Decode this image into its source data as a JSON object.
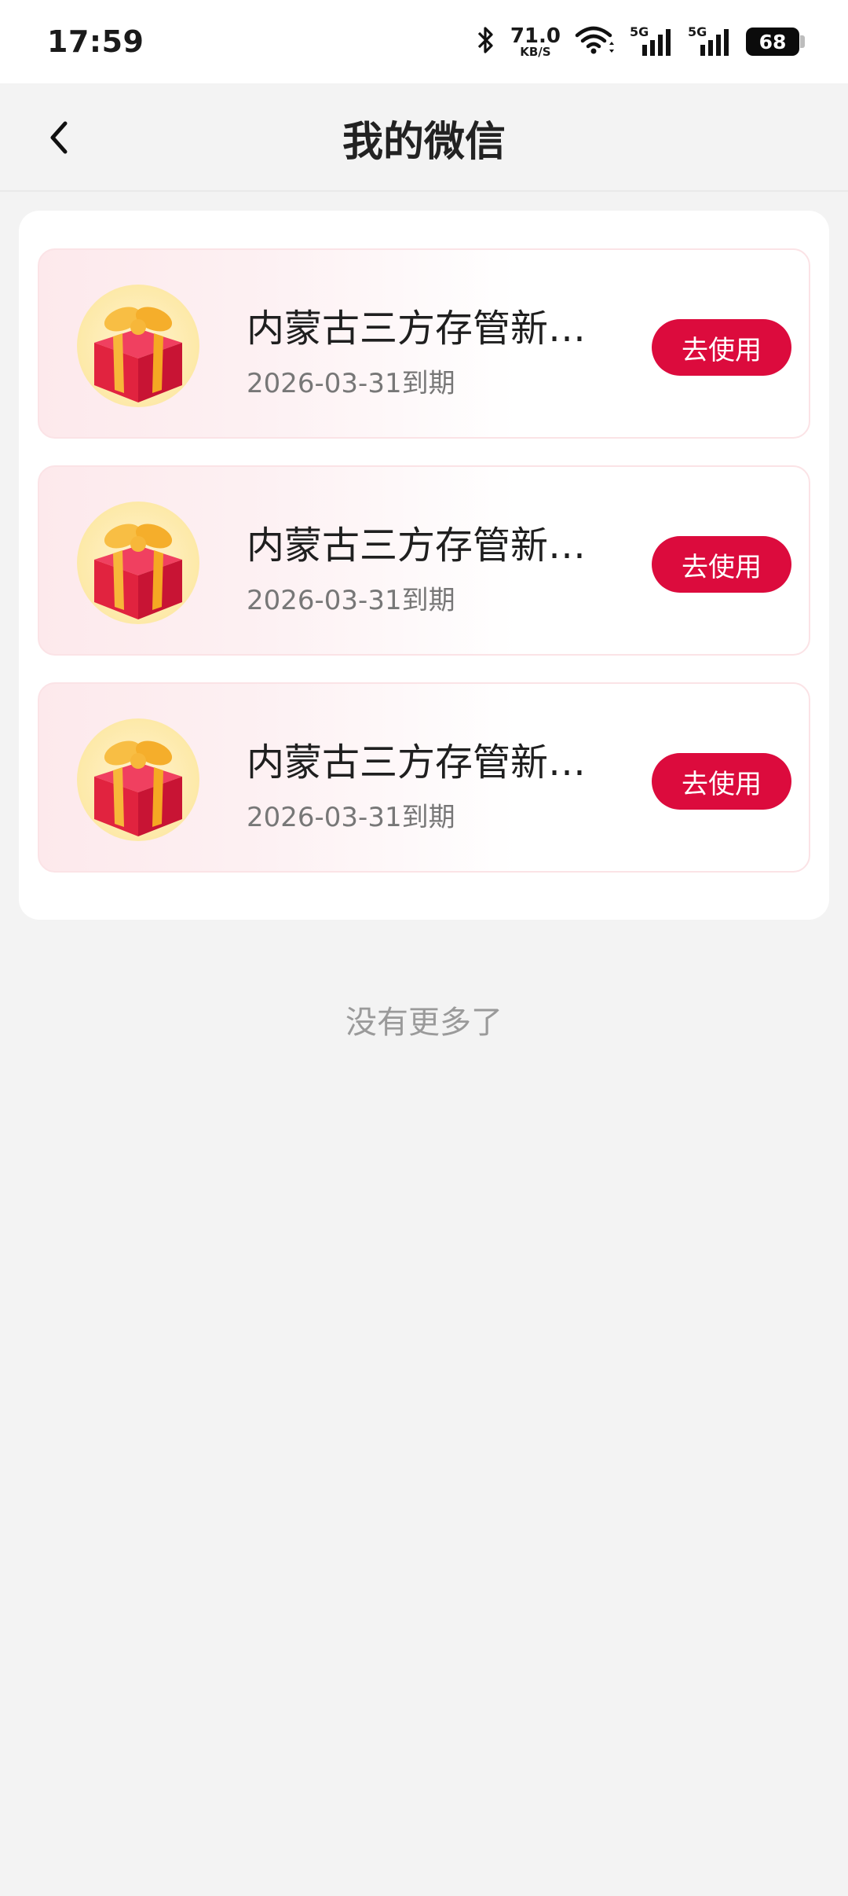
{
  "status_bar": {
    "time": "17:59",
    "net_speed_value": "71.0",
    "net_speed_unit": "KB/S",
    "signal1_label": "5G",
    "signal2_label": "5G",
    "battery": "68",
    "icons": [
      "bluetooth-icon",
      "wifi-icon",
      "signal-icon",
      "signal-icon",
      "battery-icon"
    ]
  },
  "nav": {
    "title": "我的微信",
    "back_icon": "chevron-left-icon"
  },
  "coupons": [
    {
      "title": "内蒙古三方存管新客...",
      "date": "2026-03-31到期",
      "action": "去使用",
      "icon": "gift-icon"
    },
    {
      "title": "内蒙古三方存管新客...",
      "date": "2026-03-31到期",
      "action": "去使用",
      "icon": "gift-icon"
    },
    {
      "title": "内蒙古三方存管新客...",
      "date": "2026-03-31到期",
      "action": "去使用",
      "icon": "gift-icon"
    }
  ],
  "footer": {
    "no_more": "没有更多了"
  },
  "colors": {
    "accent": "#dc0b3d",
    "background": "#f3f3f3",
    "coupon_tint": "#fde9ec"
  }
}
